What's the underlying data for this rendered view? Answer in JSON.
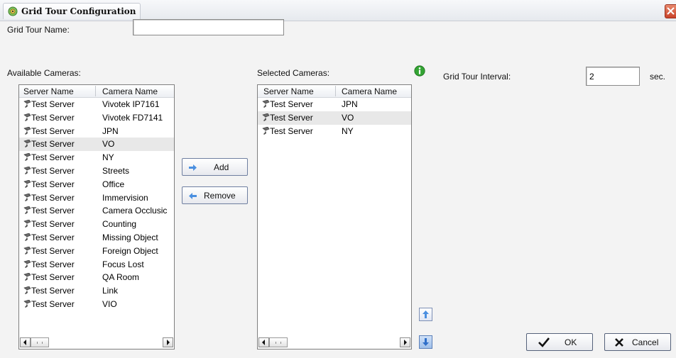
{
  "window": {
    "title": "Grid Tour Configuration",
    "close_icon": "close-icon"
  },
  "name_field": {
    "label": "Grid Tour Name:",
    "value": ""
  },
  "interval": {
    "label": "Grid Tour Interval:",
    "value": "2",
    "unit": "sec."
  },
  "available": {
    "label": "Available Cameras:",
    "columns": [
      "Server Name",
      "Camera Name"
    ],
    "rows": [
      {
        "server": "Test Server",
        "camera": "Vivotek IP7161"
      },
      {
        "server": "Test Server",
        "camera": "Vivotek FD7141"
      },
      {
        "server": "Test Server",
        "camera": "JPN"
      },
      {
        "server": "Test Server",
        "camera": "VO",
        "selected": true
      },
      {
        "server": "Test Server",
        "camera": "NY"
      },
      {
        "server": "Test Server",
        "camera": "Streets"
      },
      {
        "server": "Test Server",
        "camera": "Office"
      },
      {
        "server": "Test Server",
        "camera": "Immervision"
      },
      {
        "server": "Test Server",
        "camera": "Camera Occlusic"
      },
      {
        "server": "Test Server",
        "camera": "Counting"
      },
      {
        "server": "Test Server",
        "camera": "Missing Object"
      },
      {
        "server": "Test Server",
        "camera": "Foreign Object"
      },
      {
        "server": "Test Server",
        "camera": "Focus Lost"
      },
      {
        "server": "Test Server",
        "camera": "QA Room"
      },
      {
        "server": "Test Server",
        "camera": "Link"
      },
      {
        "server": "Test Server",
        "camera": "VIO"
      }
    ]
  },
  "selected": {
    "label": "Selected Cameras:",
    "columns": [
      "Server Name",
      "Camera Name"
    ],
    "rows": [
      {
        "server": "Test Server",
        "camera": "JPN"
      },
      {
        "server": "Test Server",
        "camera": "VO",
        "selected": true
      },
      {
        "server": "Test Server",
        "camera": "NY"
      }
    ]
  },
  "buttons": {
    "add": "Add",
    "remove": "Remove",
    "ok": "OK",
    "cancel": "Cancel"
  },
  "icons": {
    "app": "camera-app-icon",
    "info": "info-icon",
    "row": "camera-icon",
    "add": "right-arrow-icon",
    "remove": "left-arrow-icon",
    "move_up": "up-arrow-icon",
    "move_down": "down-arrow-icon",
    "ok": "checkmark-icon",
    "cancel": "x-icon"
  },
  "colors": {
    "accent_blue": "#3a7fd5",
    "info_green": "#2e9a2e",
    "close_red": "#c9432a",
    "row_selected": "#e8e8e8"
  }
}
